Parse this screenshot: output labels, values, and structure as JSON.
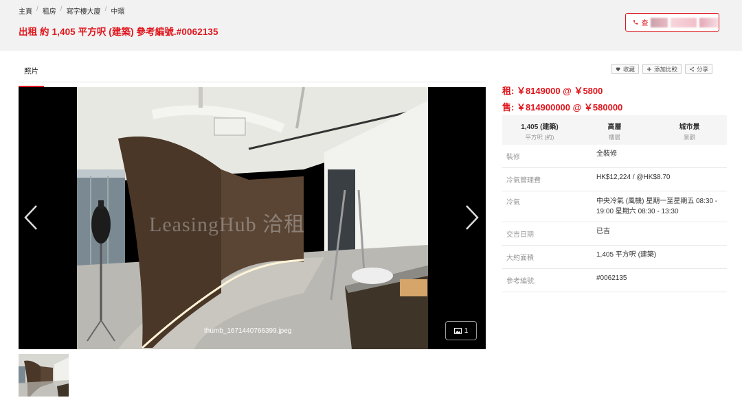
{
  "breadcrumb": [
    "主頁",
    "租房",
    "寫字樓大廈",
    "中環"
  ],
  "title": "出租 約 1,405 平方呎 (建築) 參考編號.#0062135",
  "call_button": {
    "label": "查"
  },
  "tabs": [
    {
      "label": "照片"
    }
  ],
  "actions": {
    "favorite": "收藏",
    "compare": "添加比較",
    "share": "分享"
  },
  "viewer": {
    "filename": "thumb_1671440766399.jpeg",
    "count": "1",
    "watermark": "LeasingHub 洽租"
  },
  "prices": {
    "rent": "租: ￥8149000 @ ￥5800",
    "sale": "售: ￥814900000 @ ￥580000"
  },
  "summary": [
    {
      "value": "1,405 (建築)",
      "label": "平方呎 (約)"
    },
    {
      "value": "高層",
      "label": "樓層"
    },
    {
      "value": "城市景",
      "label": "景觀"
    }
  ],
  "details": [
    {
      "key": "裝修",
      "value": "全裝修"
    },
    {
      "key": "冷氣管理費",
      "value": "HK$12,224 / @HK$8.70"
    },
    {
      "key": "冷氣",
      "value": "中央冷氣 (風機) 星期一至星期五 08:30 - 19:00 星期六 08:30 - 13:30"
    },
    {
      "key": "交吉日期",
      "value": "已吉"
    },
    {
      "key": "大約面積",
      "value": "1,405 平方呎 (建築)"
    },
    {
      "key": "參考編號.",
      "value": "#0062135"
    }
  ],
  "colors": {
    "accent": "#e0161d",
    "topbar": "#f2f2f2"
  },
  "icons": [
    "phone-icon",
    "heart-icon",
    "plus-icon",
    "share-icon",
    "chevron-left-icon",
    "chevron-right-icon",
    "image-icon"
  ]
}
